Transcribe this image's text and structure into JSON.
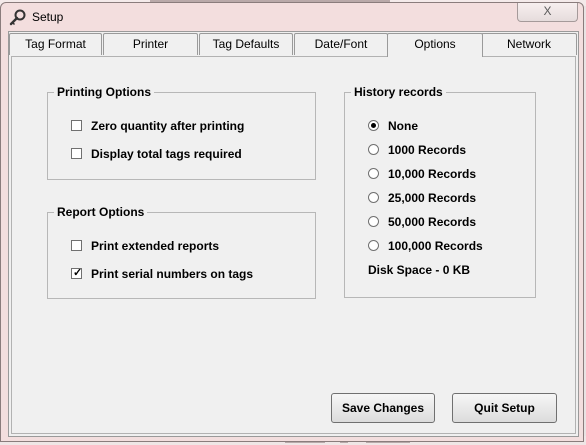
{
  "window": {
    "title": "Setup",
    "close_glyph": "X",
    "icon": "wrench-key-icon"
  },
  "tabs": [
    {
      "label": "Tag Format"
    },
    {
      "label": "Printer"
    },
    {
      "label": "Tag Defaults"
    },
    {
      "label": "Date/Font"
    },
    {
      "label": "Options",
      "active": true
    },
    {
      "label": "Network"
    }
  ],
  "printing_options": {
    "legend": "Printing Options",
    "items": [
      {
        "label": "Zero quantity after printing",
        "checked": false
      },
      {
        "label": "Display total tags required",
        "checked": false
      }
    ]
  },
  "report_options": {
    "legend": "Report Options",
    "items": [
      {
        "label": "Print extended reports",
        "checked": false
      },
      {
        "label": "Print serial numbers on tags",
        "checked": true
      }
    ]
  },
  "history_records": {
    "legend": "History records",
    "options": [
      {
        "label": "None",
        "selected": true
      },
      {
        "label": "1000 Records",
        "selected": false
      },
      {
        "label": "10,000 Records",
        "selected": false
      },
      {
        "label": "25,000 Records",
        "selected": false
      },
      {
        "label": "50,000 Records",
        "selected": false
      },
      {
        "label": "100,000 Records",
        "selected": false
      }
    ],
    "disk_space": "Disk Space - 0 KB"
  },
  "buttons": {
    "save": "Save Changes",
    "quit": "Quit Setup"
  },
  "check_glyph": "✓"
}
